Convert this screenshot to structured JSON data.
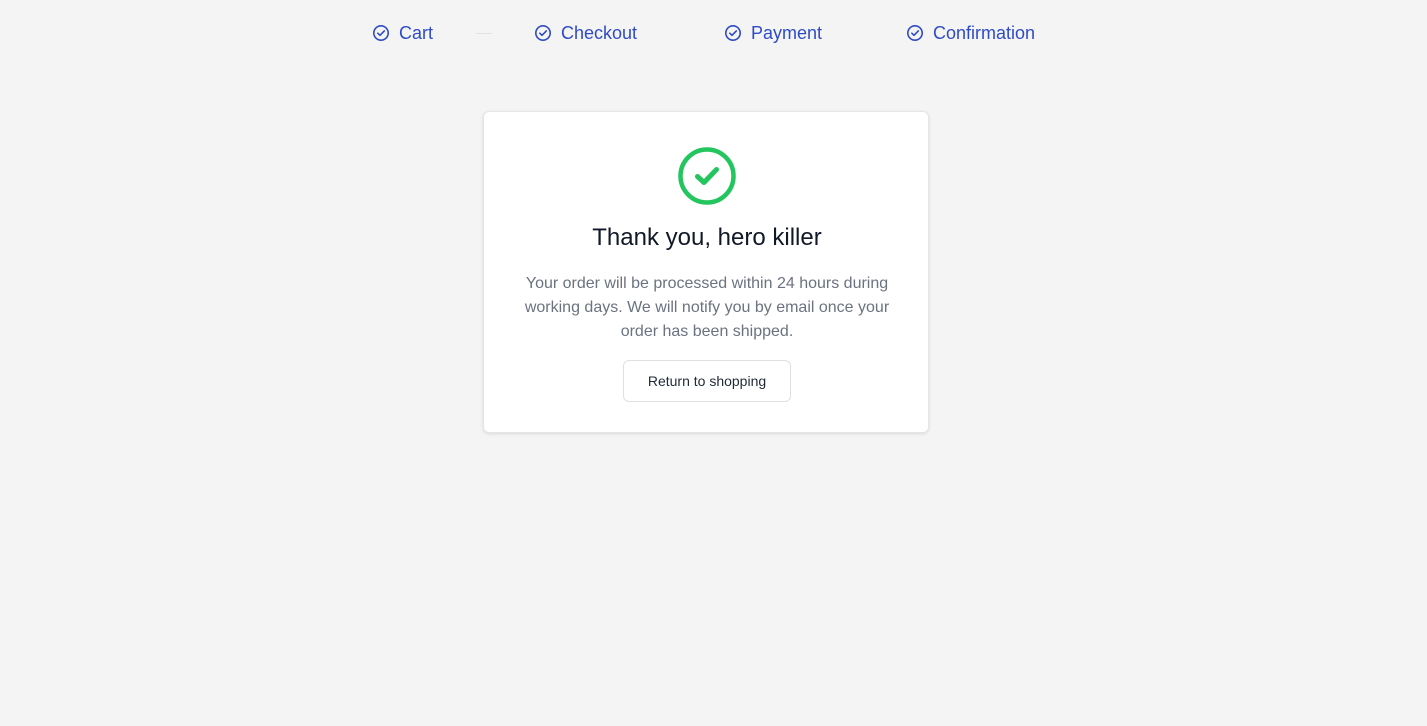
{
  "stepper": {
    "steps": [
      {
        "label": "Cart",
        "icon": "check-circle-icon"
      },
      {
        "label": "Checkout",
        "icon": "check-circle-icon"
      },
      {
        "label": "Payment",
        "icon": "check-circle-icon"
      },
      {
        "label": "Confirmation",
        "icon": "check-circle-icon"
      }
    ],
    "color": "#2f4bc4"
  },
  "confirmation": {
    "icon": "success-check-circle-icon",
    "icon_color": "#22c55e",
    "title": "Thank you, hero killer",
    "message": "Your order will be processed within 24 hours during working days. We will notify you by email once your order has been shipped.",
    "button_label": "Return to shopping"
  }
}
